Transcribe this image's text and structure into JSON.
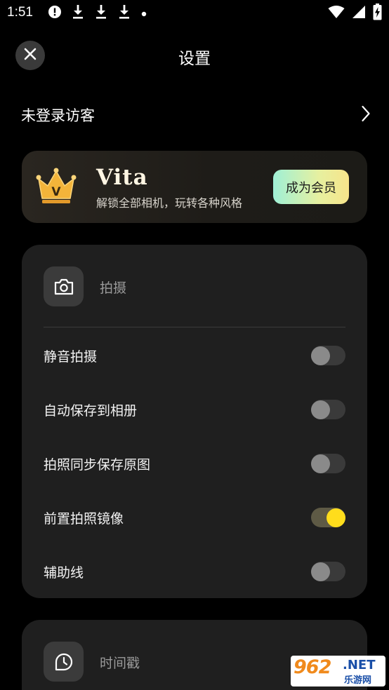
{
  "status_bar": {
    "time": "1:51",
    "left_icons": [
      "alert-icon",
      "download-icon",
      "download-icon",
      "download-icon",
      "dot-icon"
    ],
    "right_icons": [
      "wifi-icon",
      "signal-icon",
      "battery-charging-icon"
    ]
  },
  "header": {
    "title": "设置",
    "close_icon": "close-icon"
  },
  "account": {
    "name": "未登录访客",
    "chevron_icon": "chevron-right-icon"
  },
  "vip": {
    "title": "Vita",
    "subtitle": "解锁全部相机，玩转各种风格",
    "button_label": "成为会员",
    "crown_letter": "V",
    "colors": {
      "crown": "#f3b43a",
      "button_start": "#9ff0d6",
      "button_end": "#f7e48a"
    }
  },
  "shooting": {
    "section_title": "拍摄",
    "section_icon": "camera-icon",
    "rows": [
      {
        "label": "静音拍摄",
        "on": false
      },
      {
        "label": "自动保存到相册",
        "on": false
      },
      {
        "label": "拍照同步保存原图",
        "on": false
      },
      {
        "label": "前置拍照镜像",
        "on": true
      },
      {
        "label": "辅助线",
        "on": false
      }
    ]
  },
  "timestamp": {
    "section_title": "时间戳",
    "section_icon": "timestamp-icon"
  },
  "watermark": {
    "number": "962",
    "domain": ".NET",
    "site_name": "乐游网"
  },
  "colors": {
    "background": "#000000",
    "card": "#1f1f1f",
    "toggle_on": "#ffdd1c",
    "toggle_off": "#8a8a8a"
  }
}
